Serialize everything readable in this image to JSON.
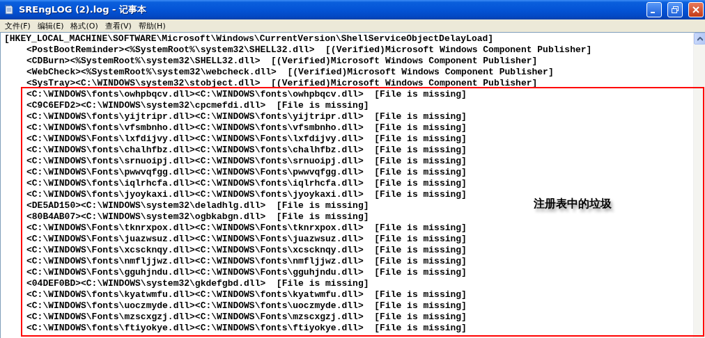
{
  "window": {
    "title": "SREngLOG (2).log - 记事本"
  },
  "menu": [
    {
      "label": "文件(F)"
    },
    {
      "label": "编辑(E)"
    },
    {
      "label": "格式(O)"
    },
    {
      "label": "查看(V)"
    },
    {
      "label": "帮助(H)"
    }
  ],
  "lines": [
    {
      "kind": "section",
      "text": "[HKEY_LOCAL_MACHINE\\SOFTWARE\\Microsoft\\Windows\\CurrentVersion\\ShellServiceObjectDelayLoad]"
    },
    {
      "kind": "entry",
      "text": "<PostBootReminder><%SystemRoot%\\system32\\SHELL32.dll>  [(Verified)Microsoft Windows Component Publisher]"
    },
    {
      "kind": "entry",
      "text": "<CDBurn><%SystemRoot%\\system32\\SHELL32.dll>  [(Verified)Microsoft Windows Component Publisher]"
    },
    {
      "kind": "entry",
      "text": "<WebCheck><%SystemRoot%\\system32\\webcheck.dll>  [(Verified)Microsoft Windows Component Publisher]"
    },
    {
      "kind": "entry",
      "text": "<SysTray><C:\\WINDOWS\\system32\\stobject.dll>  [(Verified)Microsoft Windows Component Publisher]"
    },
    {
      "kind": "entry",
      "text": "<C:\\WINDOWS\\fonts\\owhpbqcv.dll><C:\\WINDOWS\\fonts\\owhpbqcv.dll>  [File is missing]"
    },
    {
      "kind": "entry",
      "text": "<C9C6EFD2><C:\\WINDOWS\\system32\\cpcmefdi.dll>  [File is missing]"
    },
    {
      "kind": "entry",
      "text": "<C:\\WINDOWS\\fonts\\yijtripr.dll><C:\\WINDOWS\\fonts\\yijtripr.dll>  [File is missing]"
    },
    {
      "kind": "entry",
      "text": "<C:\\WINDOWS\\fonts\\vfsmbnho.dll><C:\\WINDOWS\\fonts\\vfsmbnho.dll>  [File is missing]"
    },
    {
      "kind": "entry",
      "text": "<C:\\WINDOWS\\Fonts\\lxfdijvy.dll><C:\\WINDOWS\\Fonts\\lxfdijvy.dll>  [File is missing]"
    },
    {
      "kind": "entry",
      "text": "<C:\\WINDOWS\\fonts\\chalhfbz.dll><C:\\WINDOWS\\fonts\\chalhfbz.dll>  [File is missing]"
    },
    {
      "kind": "entry",
      "text": "<C:\\WINDOWS\\fonts\\srnuoipj.dll><C:\\WINDOWS\\fonts\\srnuoipj.dll>  [File is missing]"
    },
    {
      "kind": "entry",
      "text": "<C:\\WINDOWS\\Fonts\\pwwvqfgg.dll><C:\\WINDOWS\\Fonts\\pwwvqfgg.dll>  [File is missing]"
    },
    {
      "kind": "entry",
      "text": "<C:\\WINDOWS\\fonts\\iqlrhcfa.dll><C:\\WINDOWS\\fonts\\iqlrhcfa.dll>  [File is missing]"
    },
    {
      "kind": "entry",
      "text": "<C:\\WINDOWS\\fonts\\jyoykaxi.dll><C:\\WINDOWS\\fonts\\jyoykaxi.dll>  [File is missing]"
    },
    {
      "kind": "entry",
      "text": "<DE5AD150><C:\\WINDOWS\\system32\\deladhlg.dll>  [File is missing]"
    },
    {
      "kind": "entry",
      "text": "<80B4AB07><C:\\WINDOWS\\system32\\ogbkabgn.dll>  [File is missing]"
    },
    {
      "kind": "entry",
      "text": "<C:\\WINDOWS\\Fonts\\tknrxpox.dll><C:\\WINDOWS\\Fonts\\tknrxpox.dll>  [File is missing]"
    },
    {
      "kind": "entry",
      "text": "<C:\\WINDOWS\\Fonts\\juazwsuz.dll><C:\\WINDOWS\\Fonts\\juazwsuz.dll>  [File is missing]"
    },
    {
      "kind": "entry",
      "text": "<C:\\WINDOWS\\Fonts\\xcscknqy.dll><C:\\WINDOWS\\Fonts\\xcscknqy.dll>  [File is missing]"
    },
    {
      "kind": "entry",
      "text": "<C:\\WINDOWS\\fonts\\nmfljjwz.dll><C:\\WINDOWS\\fonts\\nmfljjwz.dll>  [File is missing]"
    },
    {
      "kind": "entry",
      "text": "<C:\\WINDOWS\\Fonts\\gguhjndu.dll><C:\\WINDOWS\\Fonts\\gguhjndu.dll>  [File is missing]"
    },
    {
      "kind": "entry",
      "text": "<04DEF0BD><C:\\WINDOWS\\system32\\gkdefgbd.dll>  [File is missing]"
    },
    {
      "kind": "entry",
      "text": "<C:\\WINDOWS\\fonts\\kyatwmfu.dll><C:\\WINDOWS\\fonts\\kyatwmfu.dll>  [File is missing]"
    },
    {
      "kind": "entry",
      "text": "<C:\\WINDOWS\\fonts\\uoczmyde.dll><C:\\WINDOWS\\fonts\\uoczmyde.dll>  [File is missing]"
    },
    {
      "kind": "entry",
      "text": "<C:\\WINDOWS\\Fonts\\mzscxgzj.dll><C:\\WINDOWS\\Fonts\\mzscxgzj.dll>  [File is missing]"
    },
    {
      "kind": "entry",
      "text": "<C:\\WINDOWS\\fonts\\ftiyokye.dll><C:\\WINDOWS\\fonts\\ftiyokye.dll>  [File is missing]"
    }
  ],
  "annotation": {
    "text": "注册表中的垃圾"
  }
}
